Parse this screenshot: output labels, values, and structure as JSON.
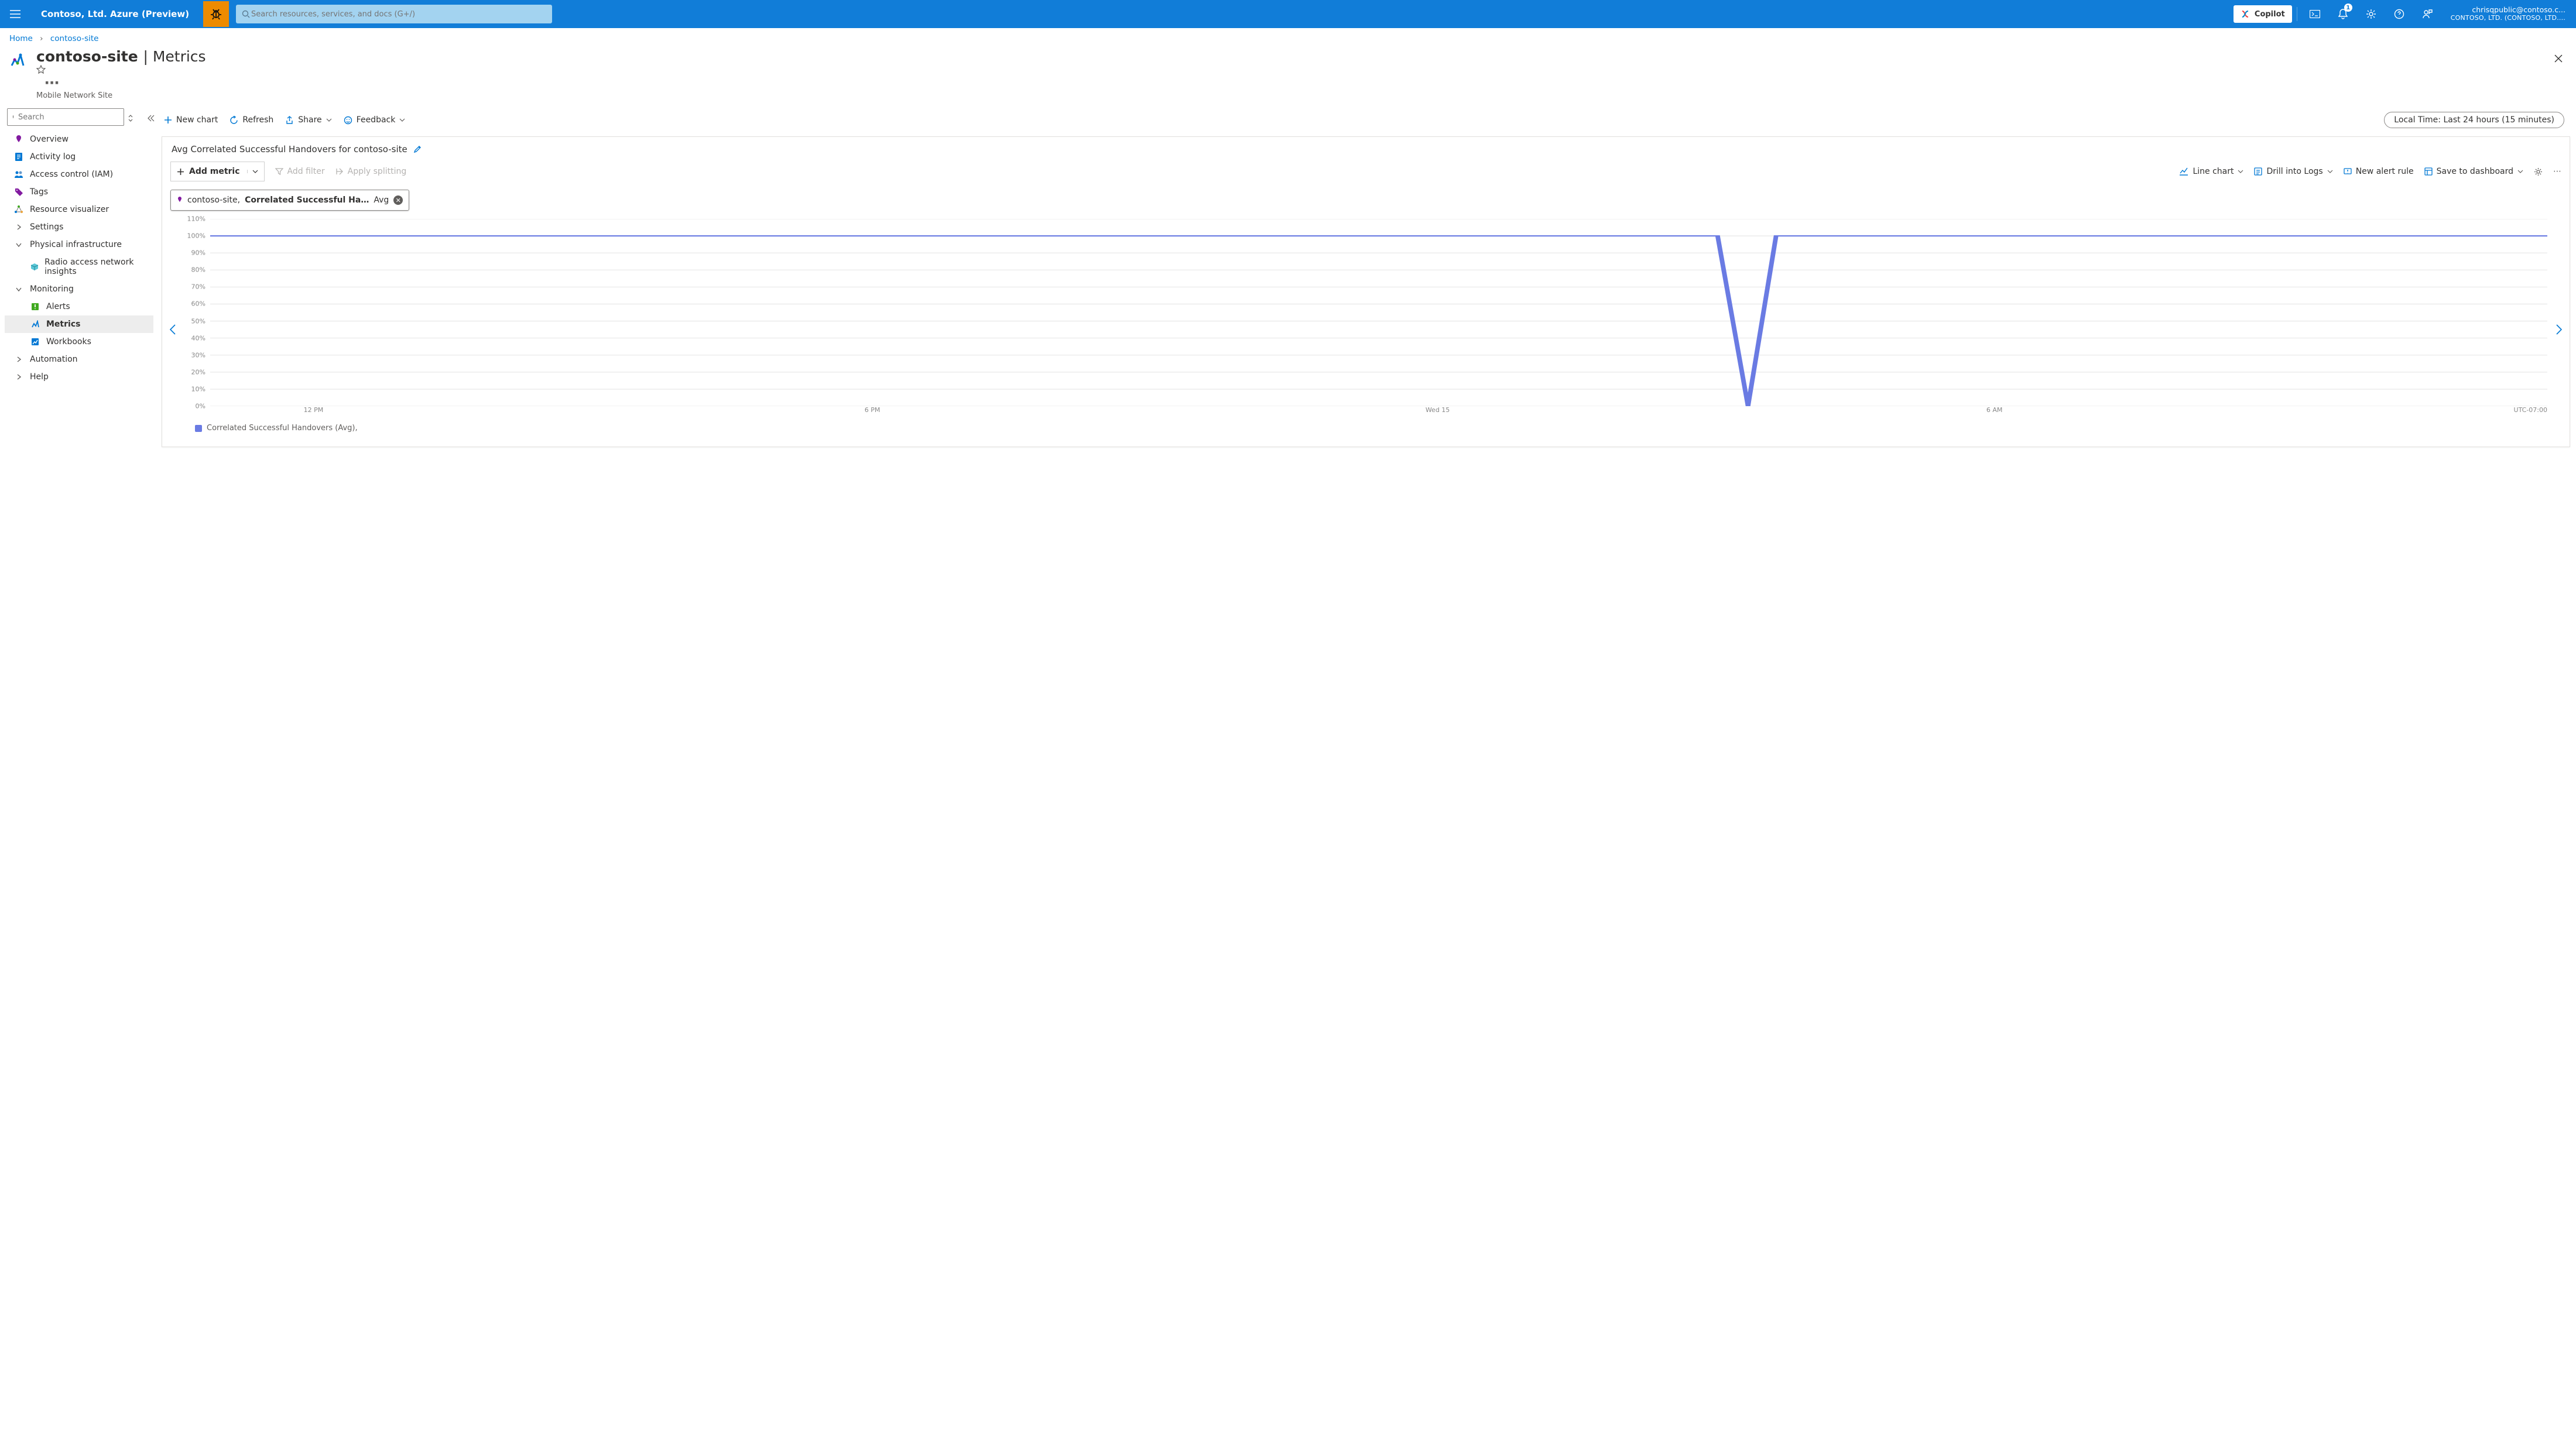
{
  "topbar": {
    "brand": "Contoso, Ltd. Azure (Preview)",
    "search_placeholder": "Search resources, services, and docs (G+/)",
    "copilot": "Copilot",
    "notif_count": "1",
    "account_email": "chrisqpublic@contoso.c...",
    "account_dir": "CONTOSO, LTD. (CONTOSO, LTD...."
  },
  "breadcrumb": {
    "home": "Home",
    "item": "contoso-site"
  },
  "header": {
    "resource": "contoso-site",
    "section": "Metrics",
    "subtitle": "Mobile Network Site"
  },
  "sidebar": {
    "search_placeholder": "Search",
    "items": [
      {
        "label": "Overview",
        "icon": "pin-icon"
      },
      {
        "label": "Activity log",
        "icon": "log-icon"
      },
      {
        "label": "Access control (IAM)",
        "icon": "people-icon"
      },
      {
        "label": "Tags",
        "icon": "tag-icon"
      },
      {
        "label": "Resource visualizer",
        "icon": "graph-icon"
      },
      {
        "label": "Settings",
        "icon": "chevron-right-icon",
        "hdr": true
      },
      {
        "label": "Physical infrastructure",
        "icon": "chevron-down-icon",
        "hdr": true
      },
      {
        "label": "Radio access network insights",
        "icon": "cube-icon",
        "child": true
      },
      {
        "label": "Monitoring",
        "icon": "chevron-down-icon",
        "hdr": true
      },
      {
        "label": "Alerts",
        "icon": "alert-icon",
        "child": true
      },
      {
        "label": "Metrics",
        "icon": "metrics-icon",
        "child": true,
        "sel": true
      },
      {
        "label": "Workbooks",
        "icon": "workbook-icon",
        "child": true
      },
      {
        "label": "Automation",
        "icon": "chevron-right-icon",
        "hdr": true
      },
      {
        "label": "Help",
        "icon": "chevron-right-icon",
        "hdr": true
      }
    ]
  },
  "commands": {
    "new_chart": "New chart",
    "refresh": "Refresh",
    "share": "Share",
    "feedback": "Feedback",
    "time": "Local Time: Last 24 hours (15 minutes)"
  },
  "card": {
    "title": "Avg Correlated Successful Handovers for contoso-site",
    "add_metric": "Add metric",
    "add_filter": "Add filter",
    "apply_splitting": "Apply splitting",
    "line_chart": "Line chart",
    "drill_logs": "Drill into Logs",
    "new_alert": "New alert rule",
    "save_dash": "Save to dashboard"
  },
  "chip": {
    "scope": "contoso-site,",
    "metric": "Correlated Successful Ha…",
    "agg": "Avg"
  },
  "legend": {
    "series": "Correlated Successful Handovers (Avg),"
  },
  "chart_data": {
    "type": "line",
    "title": "Avg Correlated Successful Handovers for contoso-site",
    "ylabel": "",
    "xlabel": "",
    "ylim": [
      0,
      110
    ],
    "y_ticks": [
      "110%",
      "100%",
      "90%",
      "80%",
      "70%",
      "60%",
      "50%",
      "40%",
      "30%",
      "20%",
      "10%",
      "0%"
    ],
    "x_ticks": [
      "12 PM",
      "6 PM",
      "Wed 15",
      "6 AM"
    ],
    "tz": "UTC-07:00",
    "series": [
      {
        "name": "Correlated Successful Handovers (Avg)",
        "color": "#6a7be3",
        "x": [
          0,
          0.645,
          0.658,
          0.67,
          1.0
        ],
        "y": [
          100,
          100,
          0,
          100,
          100
        ]
      }
    ]
  }
}
